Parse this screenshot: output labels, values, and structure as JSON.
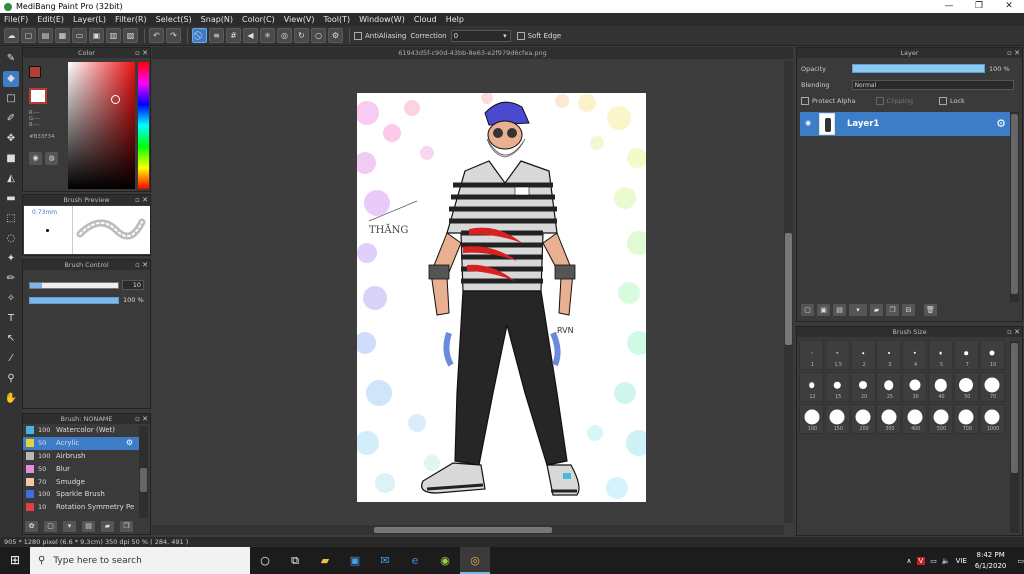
{
  "window": {
    "title": "MediBang Paint Pro (32bit)",
    "controls": [
      "—",
      "❐",
      "✕"
    ]
  },
  "menu": [
    "File(F)",
    "Edit(E)",
    "Layer(L)",
    "Filter(R)",
    "Select(S)",
    "Snap(N)",
    "Color(C)",
    "View(V)",
    "Tool(T)",
    "Window(W)",
    "Cloud",
    "Help"
  ],
  "toolbar": {
    "antialias_label": "AntiAliasing",
    "correction_label": "Correction",
    "correction_value": "0",
    "softedge_label": "Soft Edge"
  },
  "color_panel": {
    "title": "Color",
    "fg_color": "#b33f34",
    "rgb_lines": [
      "R:---",
      "G:---",
      "B:---"
    ],
    "hex": "#B33F34"
  },
  "brush_preview": {
    "title": "Brush Preview",
    "size": "0.73mm"
  },
  "brush_control": {
    "title": "Brush Control",
    "size_value": "10",
    "size_level": 0.14,
    "opacity_value": "100 %",
    "opacity_level": 1.0
  },
  "brush_list": {
    "title": "Brush: NONAME",
    "items": [
      {
        "size": "100",
        "name": "Watercolor (Wet)",
        "color": "#4ab0e6"
      },
      {
        "size": "50",
        "name": "Acrylic",
        "color": "#e6d23a"
      },
      {
        "size": "100",
        "name": "Airbrush",
        "color": "#b7b7b7"
      },
      {
        "size": "50",
        "name": "Blur",
        "color": "#e38fd8"
      },
      {
        "size": "70",
        "name": "Smudge",
        "color": "#f2c9a8"
      },
      {
        "size": "100",
        "name": "Sparkle Brush",
        "color": "#3a6fe0"
      },
      {
        "size": "10",
        "name": "Rotation Symmetry Pe",
        "color": "#e24040"
      }
    ],
    "selected_index": 1
  },
  "document": {
    "tab": "61943d5f-c90d-43bb-8e63-e2f979d6cfea.png",
    "signature_text": "THĂNG",
    "shirt_tag": "RVN"
  },
  "layer_panel": {
    "title": "Layer",
    "opacity_label": "Opacity",
    "opacity_value": "100 %",
    "blending_label": "Blending",
    "blending_value": "Normal",
    "protect_alpha": "Protect Alpha",
    "clipping": "Clipping",
    "lock": "Lock",
    "layer_name": "Layer1"
  },
  "brush_size": {
    "title": "Brush Size",
    "sizes": [
      "1",
      "1.5",
      "2",
      "3",
      "4",
      "5",
      "7",
      "10",
      "12",
      "15",
      "20",
      "25",
      "30",
      "40",
      "50",
      "70",
      "100",
      "150",
      "200",
      "300",
      "400",
      "500",
      "700",
      "1000"
    ]
  },
  "status": "905 * 1280 pixel  (6.6 * 9.3cm)  350 dpi  50 %  ( 284, 491 )",
  "taskbar": {
    "search_placeholder": "Type here to search",
    "lang": "VIE",
    "time": "8:42 PM",
    "date": "6/1/2020"
  }
}
